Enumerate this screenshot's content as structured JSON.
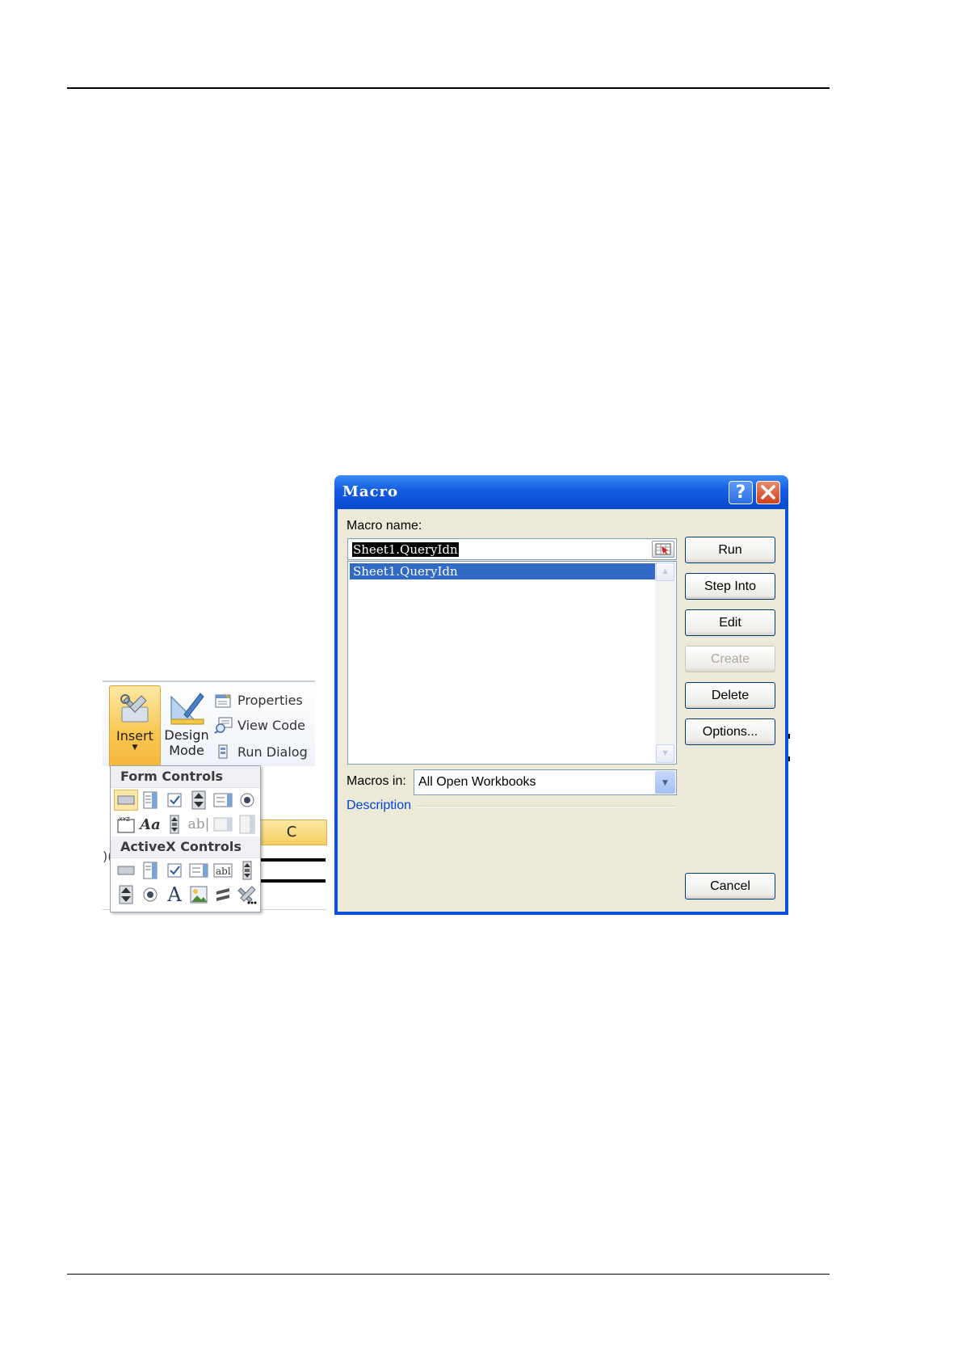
{
  "ribbon": {
    "insert_label": "Insert",
    "design_label": "Design",
    "design_label2": "Mode",
    "properties_label": "Properties",
    "view_code_label": "View Code",
    "run_dialog_label": "Run Dialog"
  },
  "dropdown": {
    "form_controls_heading": "Form Controls",
    "activex_controls_heading": "ActiveX Controls",
    "form_controls": [
      "button-icon",
      "combo-box-icon",
      "check-box-icon",
      "spin-button-icon",
      "list-box-icon",
      "option-button-icon",
      "group-box-icon",
      "label-icon",
      "scroll-bar-icon",
      "text-field-icon",
      "combo-list-edit-icon",
      "combo-drop-down-edit-icon"
    ],
    "activex_controls": [
      "command-button-icon",
      "combo-box-icon",
      "check-box-icon",
      "list-box-icon",
      "text-box-icon",
      "scroll-bar-icon",
      "spin-button-icon",
      "option-button-icon",
      "label-icon",
      "image-icon",
      "toggle-button-icon",
      "more-controls-icon"
    ]
  },
  "sheet": {
    "column_header": "C",
    "row_fragment": ")("
  },
  "dialog": {
    "title": "Macro",
    "macro_name_label": "Macro name:",
    "macro_name_value": "Sheet1.QueryIdn",
    "macro_list": [
      "Sheet1.QueryIdn"
    ],
    "macros_in_label": "Macros in:",
    "macros_in_value": "All Open Workbooks",
    "description_label": "Description",
    "buttons": {
      "run": "Run",
      "step_into": "Step Into",
      "edit": "Edit",
      "create": "Create",
      "delete": "Delete",
      "options": "Options...",
      "cancel": "Cancel"
    },
    "colors": {
      "titlebar": "#0b4fd6",
      "client": "#ece9d8",
      "selection": "#316ac5",
      "description": "#0046d5"
    }
  }
}
